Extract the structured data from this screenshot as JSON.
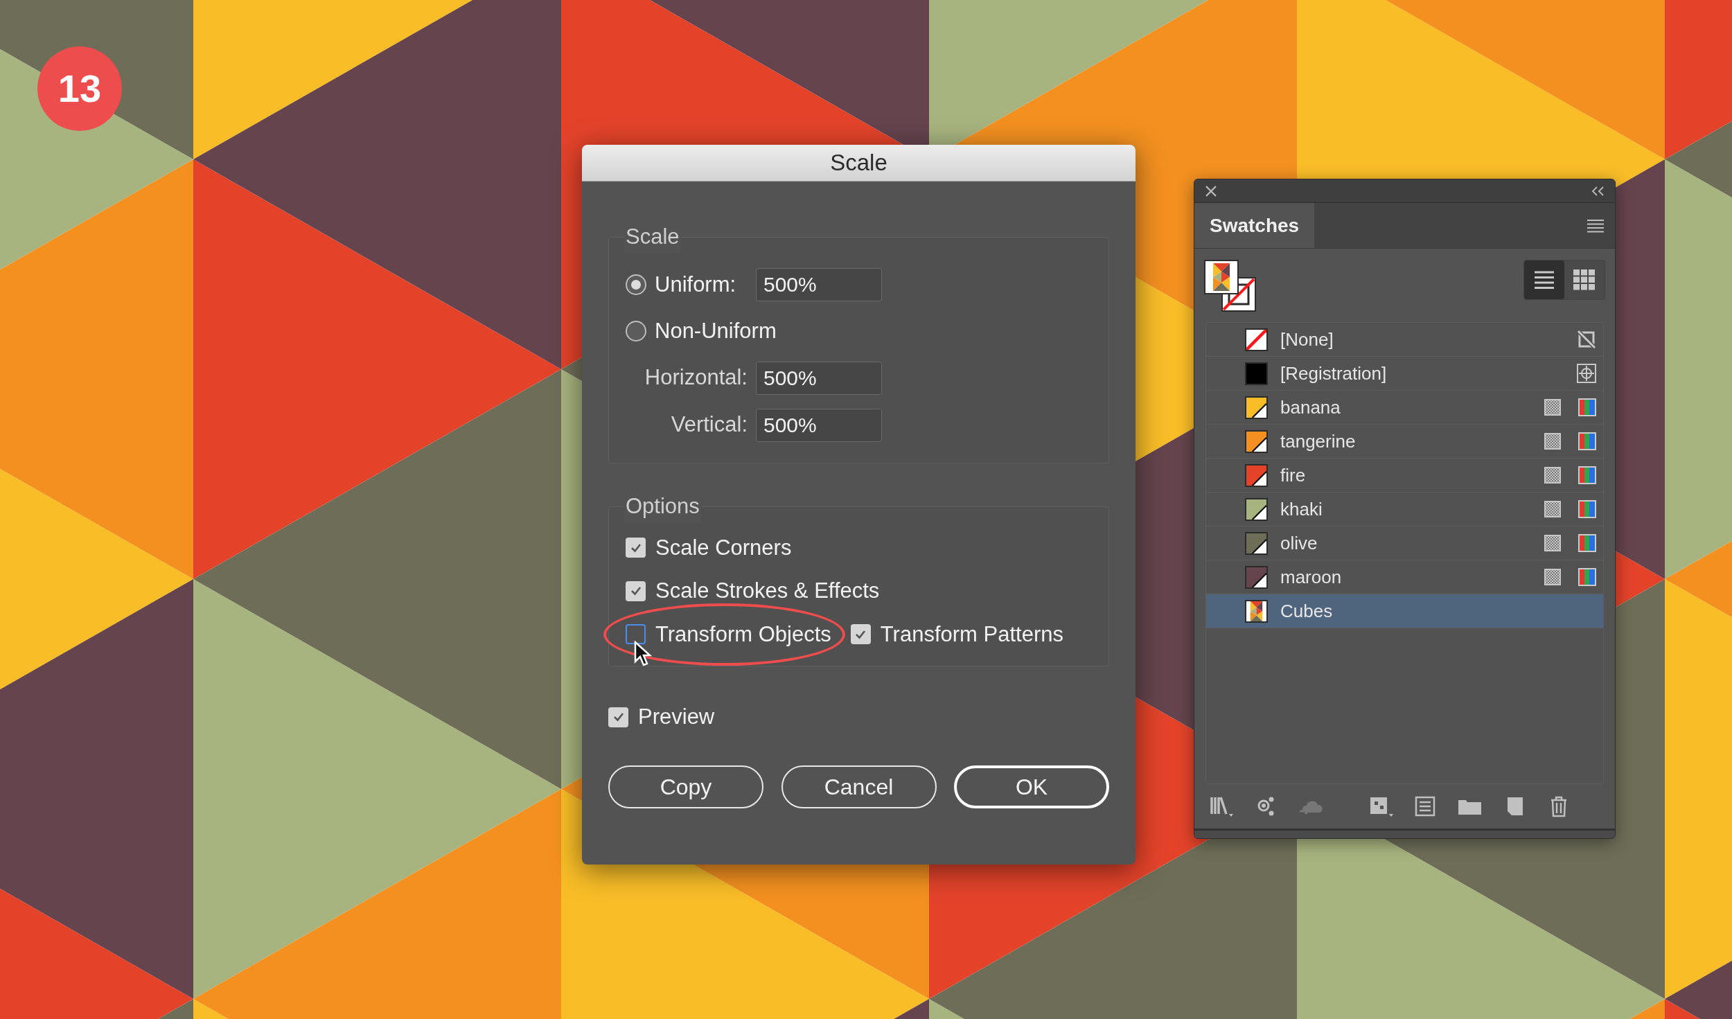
{
  "step_badge": "13",
  "dialog": {
    "title": "Scale",
    "scale_group": {
      "legend": "Scale",
      "radios": [
        {
          "label": "Uniform:",
          "selected": true,
          "value": "500%"
        },
        {
          "label": "Non-Uniform",
          "selected": false
        }
      ],
      "fields": [
        {
          "label": "Horizontal:",
          "value": "500%"
        },
        {
          "label": "Vertical:",
          "value": "500%"
        }
      ]
    },
    "options_group": {
      "legend": "Options",
      "rows": [
        [
          {
            "label": "Scale Corners",
            "checked": true,
            "highlighted": false
          }
        ],
        [
          {
            "label": "Scale Strokes & Effects",
            "checked": true,
            "highlighted": false
          }
        ],
        [
          {
            "label": "Transform Objects",
            "checked": false,
            "highlighted": true
          },
          {
            "label": "Transform Patterns",
            "checked": true,
            "highlighted": false
          }
        ]
      ]
    },
    "preview": {
      "label": "Preview",
      "checked": true
    },
    "buttons": [
      {
        "label": "Copy",
        "default": false
      },
      {
        "label": "Cancel",
        "default": false
      },
      {
        "label": "OK",
        "default": true
      }
    ]
  },
  "swatches_panel": {
    "tab": "Swatches",
    "view_buttons": [
      {
        "kind": "list",
        "selected": true
      },
      {
        "kind": "grid",
        "selected": false
      }
    ],
    "swatches": [
      {
        "name": "[None]",
        "kind": "none",
        "selected": false
      },
      {
        "name": "[Registration]",
        "kind": "registration",
        "selected": false
      },
      {
        "name": "banana",
        "kind": "color",
        "color": "#f8bd27",
        "selected": false
      },
      {
        "name": "tangerine",
        "kind": "color",
        "color": "#f39020",
        "selected": false
      },
      {
        "name": "fire",
        "kind": "color",
        "color": "#e4432a",
        "selected": false
      },
      {
        "name": "khaki",
        "kind": "color",
        "color": "#a8b47f",
        "selected": false
      },
      {
        "name": "olive",
        "kind": "color",
        "color": "#6e6e58",
        "selected": false
      },
      {
        "name": "maroon",
        "kind": "color",
        "color": "#65444e",
        "selected": false
      },
      {
        "name": "Cubes",
        "kind": "pattern",
        "selected": true
      }
    ]
  }
}
